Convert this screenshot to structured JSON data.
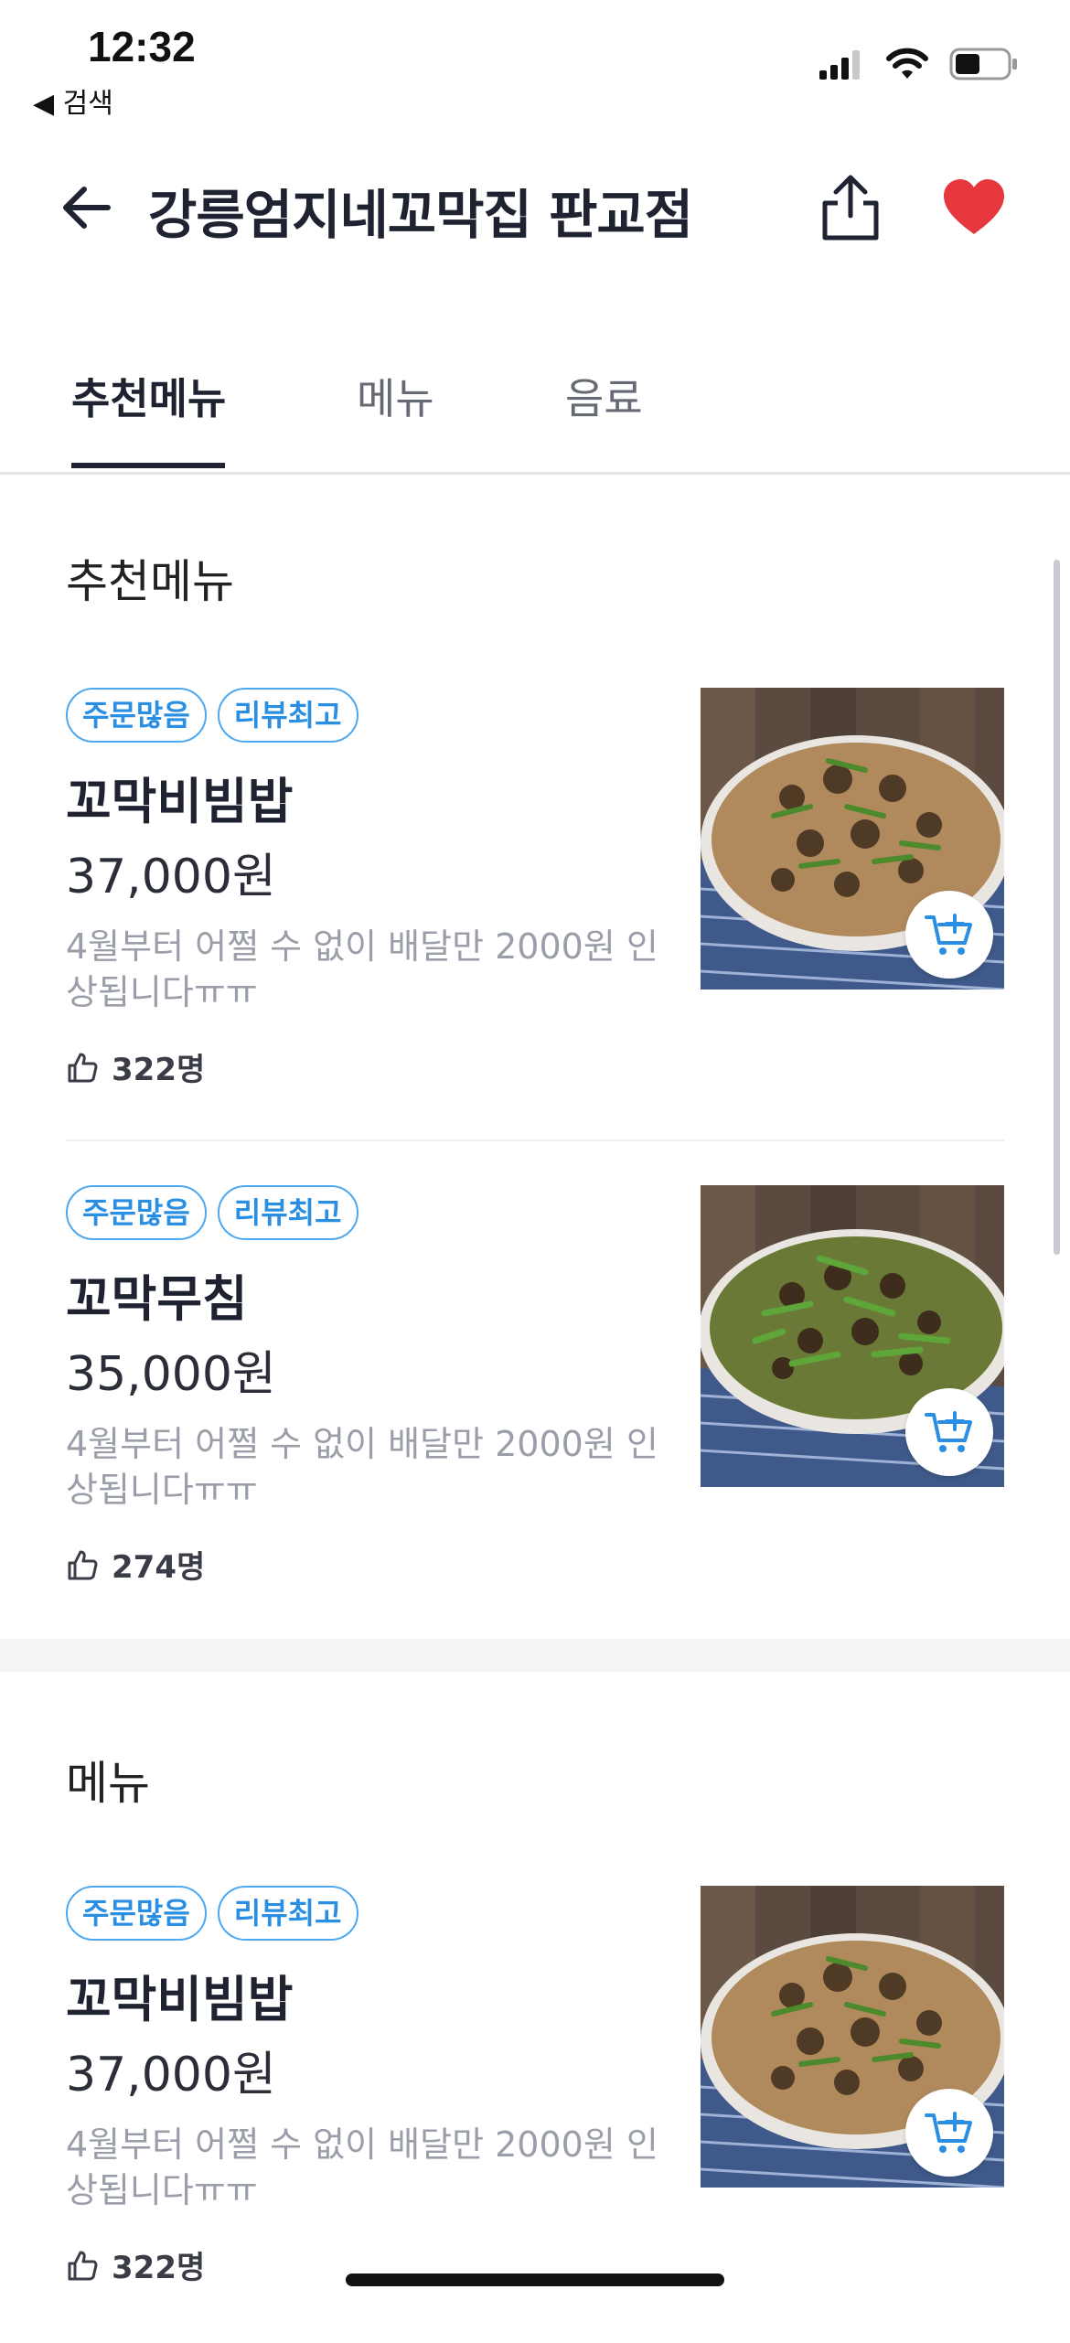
{
  "status_bar": {
    "time": "12:32",
    "back_app": "◀ 검색"
  },
  "header": {
    "title": "강릉엄지네꼬막집 판교점"
  },
  "tabs": [
    {
      "label": "추천메뉴",
      "active": true
    },
    {
      "label": "메뉴",
      "active": false
    },
    {
      "label": "음료",
      "active": false
    }
  ],
  "sections": [
    {
      "title": "추천메뉴"
    },
    {
      "title": "메뉴"
    }
  ],
  "items": [
    {
      "badges": [
        "주문많음",
        "리뷰최고"
      ],
      "name": "꼬막비빔밥",
      "price": "37,000원",
      "desc": "4월부터 어쩔 수 없이 배달만 2000원 인상됩니다ㅠㅠ",
      "likes": "322명"
    },
    {
      "badges": [
        "주문많음",
        "리뷰최고"
      ],
      "name": "꼬막무침",
      "price": "35,000원",
      "desc": "4월부터 어쩔 수 없이 배달만 2000원 인상됩니다ㅠㅠ",
      "likes": "274명"
    },
    {
      "badges": [
        "주문많음",
        "리뷰최고"
      ],
      "name": "꼬막비빔밥",
      "price": "37,000원",
      "desc": "4월부터 어쩔 수 없이 배달만 2000원 인상됩니다ㅠㅠ",
      "likes": "322명"
    }
  ],
  "colors": {
    "accent": "#2a8fe3",
    "heart": "#e5373d",
    "text_dark": "#1f2230",
    "muted": "#9a9ea8"
  },
  "icons": [
    "back-arrow-icon",
    "share-icon",
    "heart-icon",
    "thumbs-up-icon",
    "cart-plus-icon",
    "signal-icon",
    "wifi-icon",
    "battery-icon"
  ]
}
